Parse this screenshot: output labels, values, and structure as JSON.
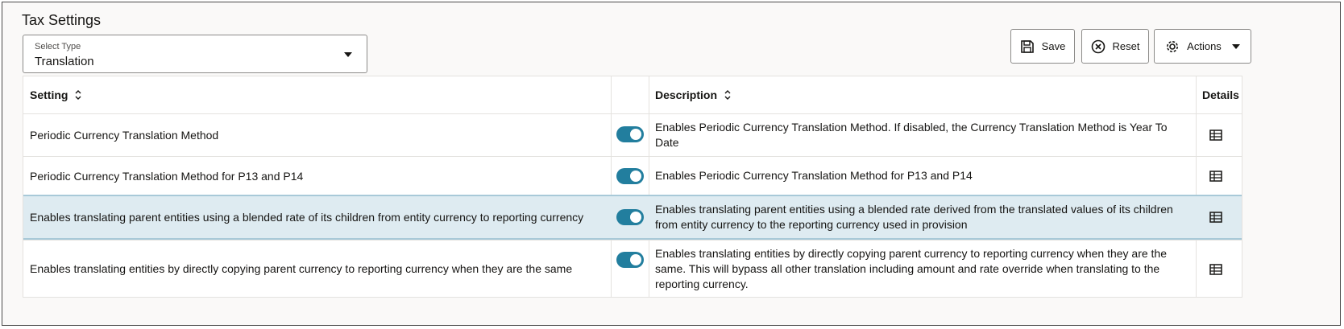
{
  "page": {
    "title": "Tax Settings"
  },
  "select_type": {
    "label": "Select Type",
    "value": "Translation"
  },
  "toolbar": {
    "save_label": "Save",
    "reset_label": "Reset",
    "actions_label": "Actions"
  },
  "table": {
    "columns": {
      "setting": "Setting",
      "description": "Description",
      "details": "Details"
    },
    "rows": [
      {
        "setting": "Periodic Currency Translation Method",
        "enabled": true,
        "description": "Enables Periodic Currency Translation Method. If disabled, the Currency Translation Method is Year To Date"
      },
      {
        "setting": "Periodic Currency Translation Method for P13 and P14",
        "enabled": true,
        "description": "Enables Periodic Currency Translation Method for P13 and P14"
      },
      {
        "setting": "Enables translating parent entities using a blended rate of its children from entity currency to reporting currency",
        "enabled": true,
        "selected": true,
        "description": "Enables translating parent entities using a blended rate derived from the translated values of its children from entity currency to the reporting currency used in provision"
      },
      {
        "setting": "Enables translating entities by directly copying parent currency to reporting currency when they are the same",
        "enabled": true,
        "description": "Enables translating entities by directly copying parent currency to reporting currency when they are the same. This will bypass all other translation including amount and rate override when translating to the reporting currency."
      }
    ]
  },
  "colors": {
    "accent": "#227e9e",
    "selected_row": "#deebf1",
    "border": "#e4e2df"
  },
  "icons": {
    "save": "save-icon",
    "reset": "reset-icon",
    "actions": "gear-icon",
    "sort": "sort-icon",
    "details": "details-icon"
  }
}
